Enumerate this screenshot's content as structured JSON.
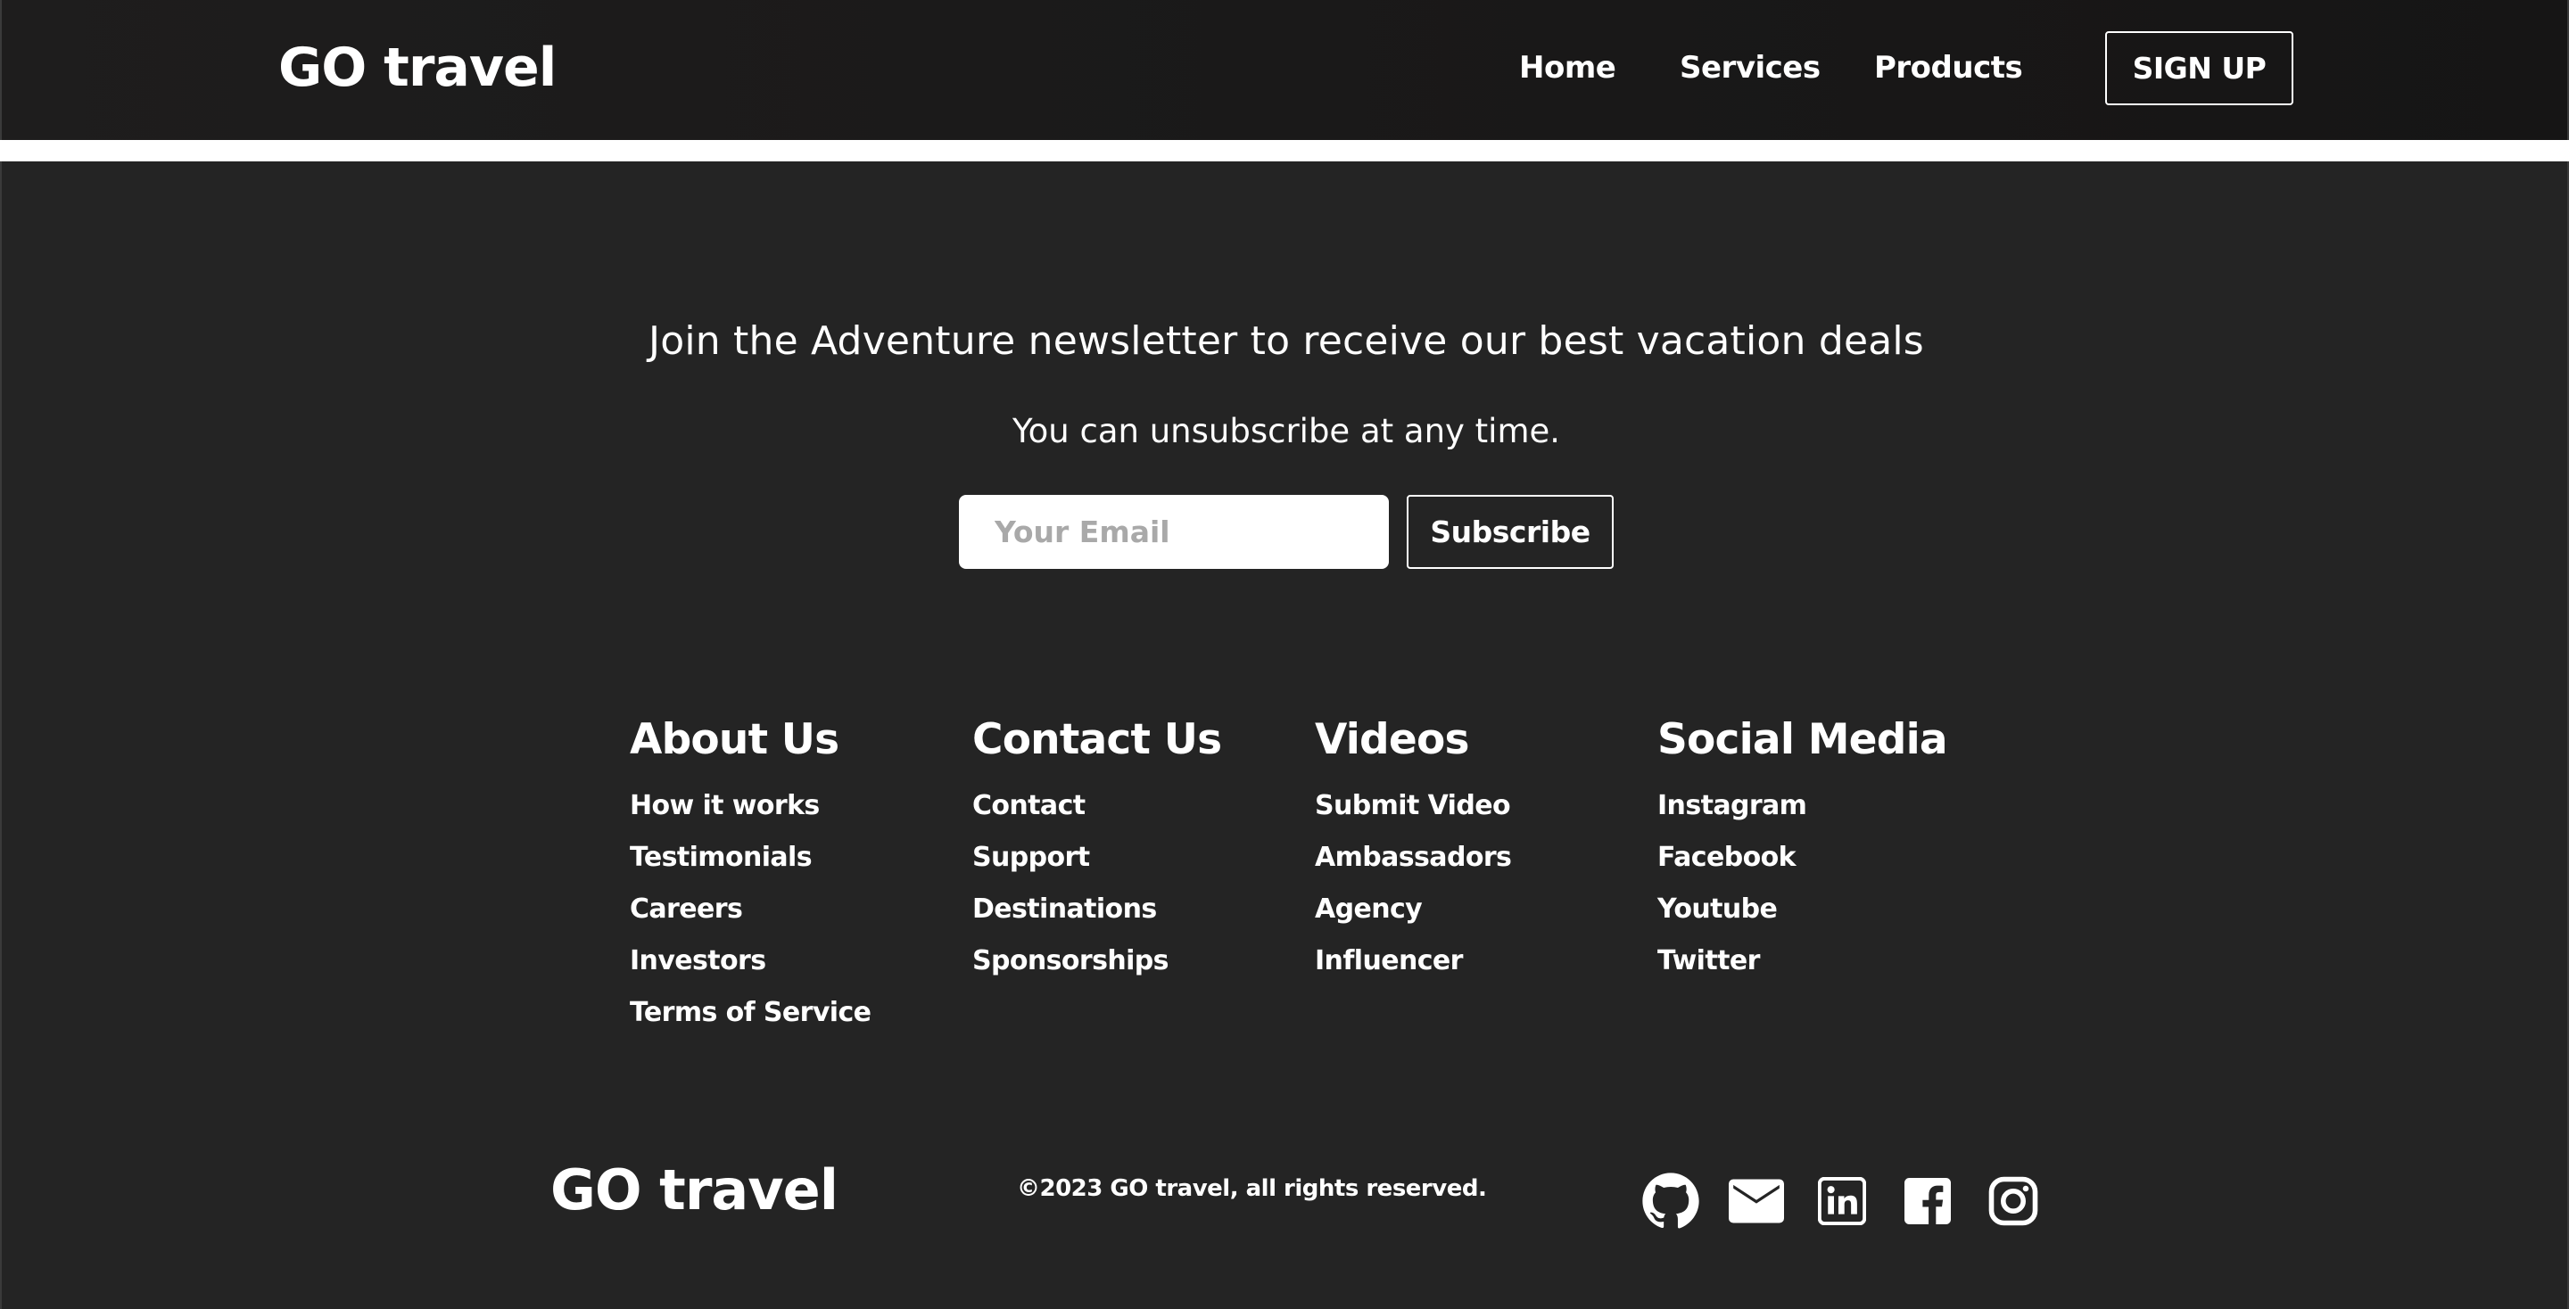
{
  "navbar": {
    "logo": "GO travel",
    "links": [
      {
        "label": "Home"
      },
      {
        "label": "Services"
      },
      {
        "label": "Products"
      }
    ],
    "signup_label": "SIGN UP"
  },
  "newsletter": {
    "heading": "Join the Adventure newsletter to receive our best vacation deals",
    "subheading": "You can unsubscribe at any time.",
    "email_placeholder": "Your Email",
    "email_value": "",
    "subscribe_label": "Subscribe"
  },
  "footer_links": [
    {
      "title": "About Us",
      "items": [
        "How it works",
        "Testimonials",
        "Careers",
        "Investors",
        "Terms of Service"
      ]
    },
    {
      "title": "Contact Us",
      "items": [
        "Contact",
        "Support",
        "Destinations",
        "Sponsorships"
      ]
    },
    {
      "title": "Videos",
      "items": [
        "Submit Video",
        "Ambassadors",
        "Agency",
        "Influencer"
      ]
    },
    {
      "title": "Social Media",
      "items": [
        "Instagram",
        "Facebook",
        "Youtube",
        "Twitter"
      ]
    }
  ],
  "footer_bottom": {
    "logo": "GO travel",
    "copyright": "©2023 GO travel, all rights reserved.",
    "social_icons": [
      "github-icon",
      "mail-icon",
      "linkedin-icon",
      "facebook-icon",
      "instagram-icon"
    ]
  },
  "colors": {
    "navbar_bg": "#1b1a1a",
    "footer_bg": "#242424",
    "text": "#ffffff",
    "placeholder": "#a9a9a9"
  }
}
